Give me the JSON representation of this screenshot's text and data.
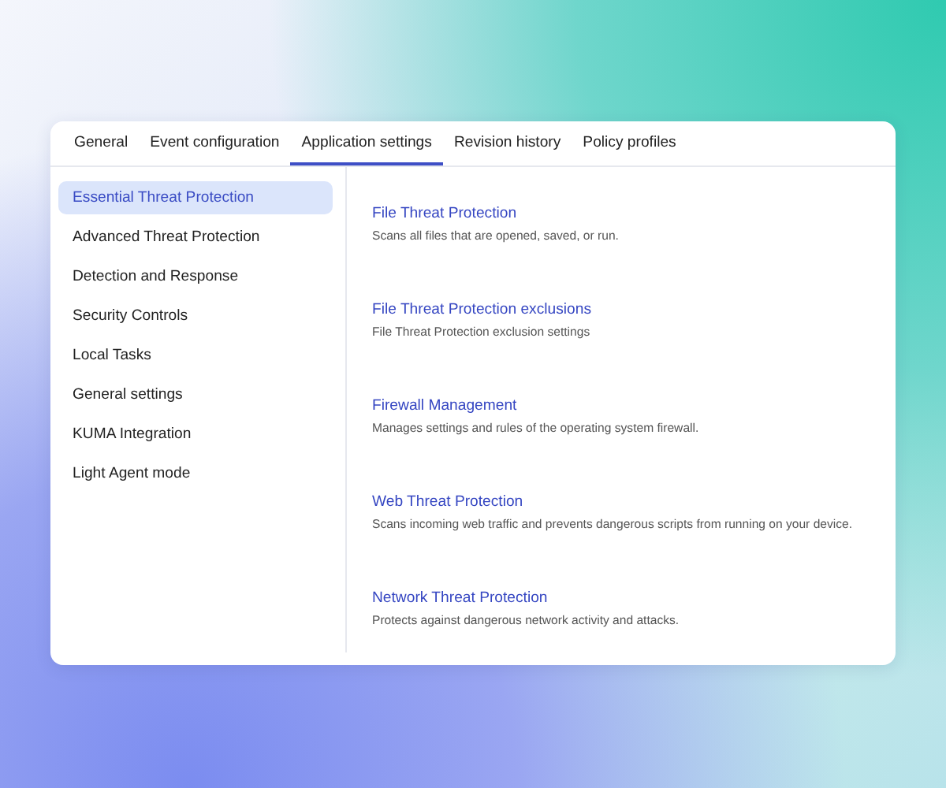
{
  "tabs": [
    {
      "label": "General",
      "selected": false
    },
    {
      "label": "Event configuration",
      "selected": false
    },
    {
      "label": "Application settings",
      "selected": true
    },
    {
      "label": "Revision history",
      "selected": false
    },
    {
      "label": "Policy profiles",
      "selected": false
    }
  ],
  "sidebar": {
    "items": [
      {
        "label": "Essential Threat Protection",
        "selected": true
      },
      {
        "label": "Advanced Threat Protection",
        "selected": false
      },
      {
        "label": "Detection and Response",
        "selected": false
      },
      {
        "label": "Security Controls",
        "selected": false
      },
      {
        "label": "Local Tasks",
        "selected": false
      },
      {
        "label": "General settings",
        "selected": false
      },
      {
        "label": "KUMA Integration",
        "selected": false
      },
      {
        "label": "Light Agent mode",
        "selected": false
      }
    ]
  },
  "sections": [
    {
      "title": "File Threat Protection",
      "description": "Scans all files that are opened, saved, or run."
    },
    {
      "title": "File Threat Protection exclusions",
      "description": "File Threat Protection exclusion settings"
    },
    {
      "title": "Firewall Management",
      "description": "Manages settings and rules of the operating system firewall."
    },
    {
      "title": "Web Threat Protection",
      "description": "Scans incoming web traffic and prevents dangerous scripts from running on your device."
    },
    {
      "title": "Network Threat Protection",
      "description": "Protects against dangerous network activity and attacks."
    }
  ]
}
